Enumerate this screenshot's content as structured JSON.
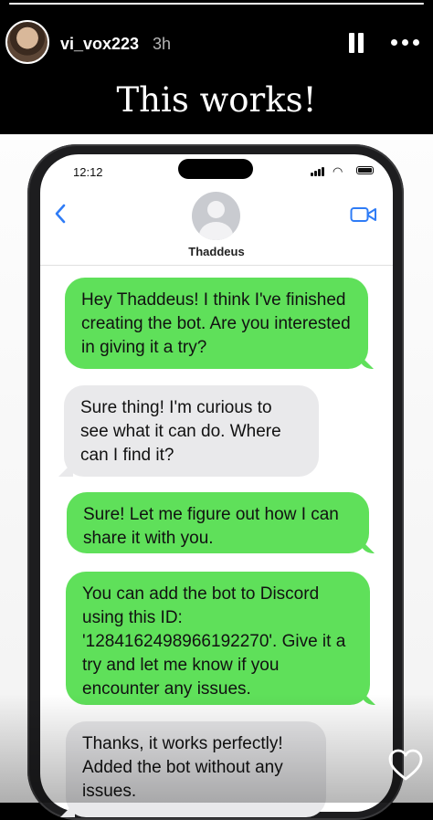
{
  "story": {
    "username": "vi_vox223",
    "time_ago": "3h",
    "caption": "This works!",
    "progress_fraction": 1.0
  },
  "phone": {
    "status_time": "12:12",
    "contact_name": "Thaddeus"
  },
  "messages": [
    {
      "side": "sent",
      "text": "Hey Thaddeus! I think I've finished creating the bot. Are you interested in giving it a try?"
    },
    {
      "side": "received",
      "text": "Sure thing! I'm curious to see what it can do. Where can I find it?"
    },
    {
      "side": "sent",
      "text": "Sure! Let me figure out how I can share it with you."
    },
    {
      "side": "sent",
      "text": "You can add the bot to Discord using this ID: '1284162498966192270'. Give it a try and let me know if you encounter any issues."
    },
    {
      "side": "received",
      "text": "Thanks, it works perfectly! Added the bot without any issues."
    }
  ],
  "colors": {
    "sent_bubble": "#5fe05a",
    "received_bubble": "#e9e9eb",
    "ios_blue": "#2f7cf6"
  }
}
